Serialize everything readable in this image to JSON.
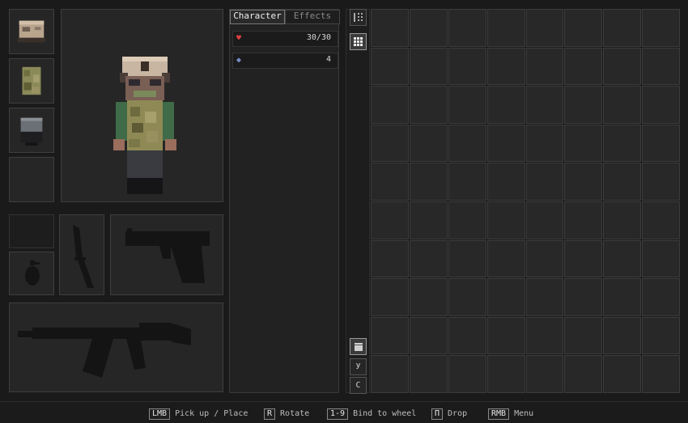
{
  "tabs": [
    {
      "label": "Character",
      "active": true
    },
    {
      "label": "Effects",
      "active": false
    }
  ],
  "stats": [
    {
      "icon": "heart-icon",
      "glyph": "♥",
      "color": "#e04040",
      "value": "30/30"
    },
    {
      "icon": "armor-icon",
      "glyph": "◆",
      "color": "#7a8cc8",
      "value": "4"
    }
  ],
  "equipment": [
    {
      "slot": "head",
      "item": "helmet"
    },
    {
      "slot": "chest",
      "item": "camo-vest"
    },
    {
      "slot": "legs",
      "item": "backpack"
    },
    {
      "slot": "feet",
      "item": ""
    }
  ],
  "weapons": [
    "knife",
    "pistol",
    "grenade",
    "assault-rifle"
  ],
  "side_buttons": {
    "top": [
      {
        "icon": "list-view-icon",
        "active": false
      },
      {
        "icon": "grid-view-icon",
        "active": true
      }
    ],
    "bottom": [
      {
        "icon": "container-icon",
        "label": "",
        "active": true
      },
      {
        "icon": "",
        "label": "У",
        "active": false
      },
      {
        "icon": "",
        "label": "C",
        "active": false
      }
    ]
  },
  "inventory": {
    "columns": 8,
    "rows": 10
  },
  "hints": [
    {
      "key": "LMB",
      "label": "Pick up / Place"
    },
    {
      "key": "R",
      "label": "Rotate"
    },
    {
      "key": "1-9",
      "label": "Bind to wheel"
    },
    {
      "key": "П",
      "label": "Drop"
    },
    {
      "key": "RMB",
      "label": "Menu"
    }
  ]
}
